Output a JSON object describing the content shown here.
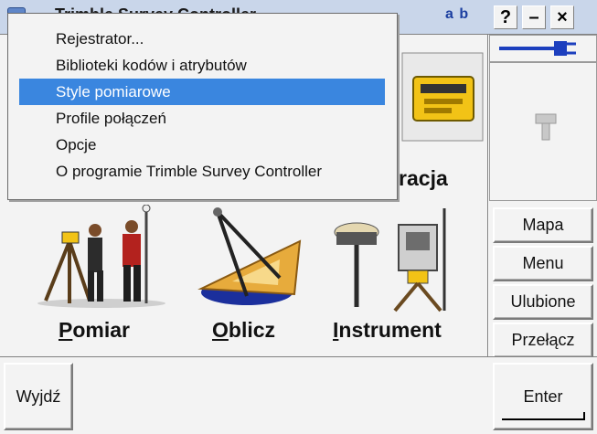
{
  "titlebar": {
    "title": "Trimble Survey Controller",
    "input_mode": "a b",
    "help": "?",
    "minimize": "–",
    "close": "×"
  },
  "menu": {
    "items": [
      {
        "label": "Rejestrator...",
        "selected": false
      },
      {
        "label": "Biblioteki kodów i atrybutów",
        "selected": false
      },
      {
        "label": "Style pomiarowe",
        "selected": true
      },
      {
        "label": "Profile połączeń",
        "selected": false
      },
      {
        "label": "Opcje",
        "selected": false
      },
      {
        "label": "O programie Trimble Survey Controller",
        "selected": false
      }
    ]
  },
  "apps": {
    "config_label_partial": "uracja",
    "pomiar": {
      "first": "P",
      "rest": "omiar"
    },
    "oblicz": {
      "first": "O",
      "rest": "blicz"
    },
    "instrument": {
      "first": "I",
      "rest": "nstrument"
    }
  },
  "side": {
    "mapa": "Mapa",
    "menu": "Menu",
    "ulubione": "Ulubione",
    "przelacz": "Przełącz"
  },
  "bottom": {
    "exit": "Wyjdź",
    "enter": "Enter"
  },
  "colors": {
    "titlebar": "#c9d6ea",
    "selection": "#3a86df",
    "connector": "#1c3fbe"
  }
}
